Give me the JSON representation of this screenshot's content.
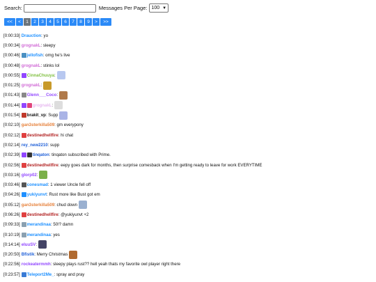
{
  "search": {
    "label": "Search:",
    "value": "",
    "per_page_label": "Messages Per Page:",
    "per_page_value": "100"
  },
  "pagination": [
    "<<",
    "<",
    "1",
    "2",
    "3",
    "4",
    "5",
    "6",
    "7",
    "8",
    "9",
    ">",
    ">>"
  ],
  "messages": [
    {
      "time": "[0:00:33]",
      "user": "Drauction",
      "color": "#1e90ff",
      "text": ": yo",
      "badges": [],
      "emotes": []
    },
    {
      "time": "[0:00:34]",
      "user": "grognakL",
      "color": "#d16bd6",
      "text": ": sleepy",
      "badges": [],
      "emotes": []
    },
    {
      "time": "[0:00:46]",
      "user": "jellofish",
      "color": "#1e90ff",
      "text": ": omg he's live",
      "badges": [
        "#4a90c2"
      ],
      "emotes": []
    },
    {
      "time": "[0:00:48]",
      "user": "grognakL",
      "color": "#d16bd6",
      "text": ": stinks lol",
      "badges": [],
      "emotes": []
    },
    {
      "time": "[0:00:55]",
      "user": "CinnaChuuya",
      "color": "#7fbf3f",
      "text": ":",
      "badges": [
        "#9146ff"
      ],
      "emotes": [
        "#b8c8f0"
      ]
    },
    {
      "time": "[0:01:25]",
      "user": "grognakL",
      "color": "#d16bd6",
      "text": ":",
      "badges": [],
      "emotes": [
        "#c89a2a"
      ]
    },
    {
      "time": "[0:01:43]",
      "user": "Glenn___Coco",
      "color": "#9146ff",
      "text": ":",
      "badges": [
        "#888888"
      ],
      "emotes": [
        "#b07a4a"
      ]
    },
    {
      "time": "[0:01:44]",
      "user": "grognakL",
      "color": "#e7b9f0",
      "text": ":",
      "badges": [
        "#9146ff",
        "#e0457b"
      ],
      "emotes": [
        "#dddddd"
      ]
    },
    {
      "time": "[0:01:54]",
      "user": "brakit_vp",
      "color": "#111111",
      "text": ": Supp",
      "badges": [
        "#c0392b"
      ],
      "emotes": [
        "#aab4e6"
      ]
    },
    {
      "time": "[0:02:10]",
      "user": "gan3sterkilla509",
      "color": "#e6803a",
      "text": ": gm everypony",
      "badges": [],
      "emotes": []
    },
    {
      "time": "[0:02:12]",
      "user": "destinedhellfire",
      "color": "#b22222",
      "text": ": hi chat",
      "badges": [
        "#e04040"
      ],
      "emotes": []
    },
    {
      "time": "[0:02:14]",
      "user": "rey_new2210",
      "color": "#1e5fd8",
      "text": ": supp",
      "badges": [],
      "emotes": []
    },
    {
      "time": "[0:02:39]",
      "user": "tinqaton",
      "color": "#1e5fd8",
      "text": ": tinqaton subscribed with Prime.",
      "badges": [
        "#9146ff",
        "#333333"
      ],
      "emotes": []
    },
    {
      "time": "[0:02:56]",
      "user": "destinedhellfire",
      "color": "#b22222",
      "text": ": eepy goes dark for months, then surprise comesback when I'm getting ready to leave for work EVERYTIME",
      "badges": [
        "#e04040"
      ],
      "emotes": []
    },
    {
      "time": "[0:03:16]",
      "user": "glorp02",
      "color": "#9146ff",
      "text": ":",
      "badges": [],
      "emotes": [
        "#7bb04a"
      ]
    },
    {
      "time": "[0:03:46]",
      "user": "conesmad",
      "color": "#1e90ff",
      "text": ": 1 viewer Uncle fell off",
      "badges": [
        "#555555"
      ],
      "emotes": []
    },
    {
      "time": "[0:04:26]",
      "user": "yukiyunvt",
      "color": "#1e90ff",
      "text": ": Rust more like Bust got em",
      "badges": [
        "#1e90ff"
      ],
      "emotes": []
    },
    {
      "time": "[0:05:12]",
      "user": "gan3sterkilla509",
      "color": "#e6803a",
      "text": ": chud down",
      "badges": [],
      "emotes": [
        "#9ab0d0"
      ]
    },
    {
      "time": "[0:06:26]",
      "user": "destinedhellfire",
      "color": "#b22222",
      "text": ": @yukiyunvt +2",
      "badges": [
        "#e04040"
      ],
      "emotes": []
    },
    {
      "time": "[0:09:33]",
      "user": "merandinaa",
      "color": "#1e90ff",
      "text": ": 50!? damn",
      "badges": [
        "#8aa0b0"
      ],
      "emotes": []
    },
    {
      "time": "[0:10:19]",
      "user": "merandinaa",
      "color": "#1e90ff",
      "text": ": yes",
      "badges": [
        "#8aa0b0"
      ],
      "emotes": []
    },
    {
      "time": "[0:14:14]",
      "user": "eluuSV",
      "color": "#9146ff",
      "text": ":",
      "badges": [],
      "emotes": [
        "#444466"
      ]
    },
    {
      "time": "[0:20:50]",
      "user": "Bfistik",
      "color": "#1e5fd8",
      "text": ": Merry Christmas",
      "badges": [],
      "emotes": [
        "#b06a30"
      ]
    },
    {
      "time": "[0:22:56]",
      "user": "rockeatermmh",
      "color": "#9146ff",
      "text": ": sleepy plays rust?? hell yeah thats my favorite owl player right there",
      "badges": [],
      "emotes": []
    },
    {
      "time": "[0:23:57]",
      "user": "Teleport2Me_",
      "color": "#1e90ff",
      "text": ": spray and pray",
      "badges": [
        "#3a7bd5"
      ],
      "emotes": []
    }
  ]
}
